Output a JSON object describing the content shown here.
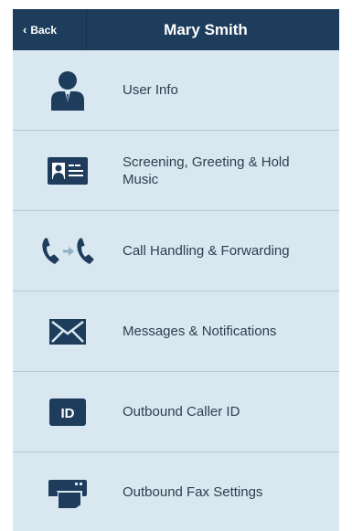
{
  "header": {
    "back_label": "Back",
    "title": "Mary Smith"
  },
  "menu": {
    "items": [
      {
        "label": "User Info",
        "icon": "user-icon"
      },
      {
        "label": "Screening, Greeting & Hold Music",
        "icon": "id-card-icon"
      },
      {
        "label": "Call Handling & Forwarding",
        "icon": "call-forward-icon"
      },
      {
        "label": "Messages & Notifications",
        "icon": "envelope-icon"
      },
      {
        "label": "Outbound Caller ID",
        "icon": "caller-id-icon",
        "badge_text": "ID"
      },
      {
        "label": "Outbound Fax Settings",
        "icon": "fax-icon"
      }
    ]
  },
  "colors": {
    "header_bg": "#1e3d5c",
    "list_bg": "#d9e8f0",
    "icon": "#1e3d5c",
    "text": "#2d3e4e"
  }
}
